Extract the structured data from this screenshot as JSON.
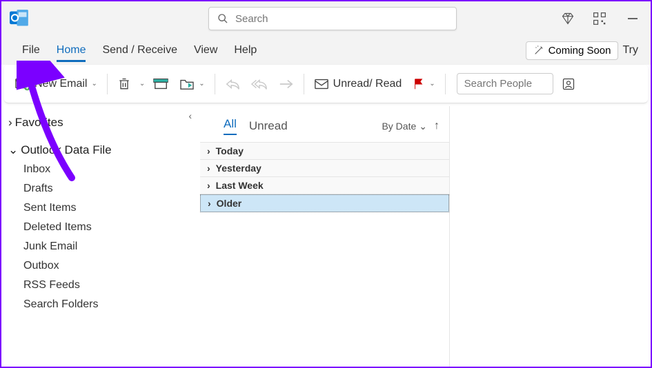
{
  "titlebar": {
    "search_placeholder": "Search"
  },
  "menubar": {
    "items": [
      "File",
      "Home",
      "Send / Receive",
      "View",
      "Help"
    ],
    "active_index": 1,
    "coming_soon": "Coming Soon",
    "try_label": "Try"
  },
  "ribbon": {
    "new_email": "New Email",
    "unread_read": "Unread/ Read",
    "search_people_placeholder": "Search People"
  },
  "sidebar": {
    "favorites_label": "Favorites",
    "datafile_label": "Outlook Data File",
    "folders": [
      "Inbox",
      "Drafts",
      "Sent Items",
      "Deleted Items",
      "Junk Email",
      "Outbox",
      "RSS Feeds",
      "Search Folders"
    ]
  },
  "listpane": {
    "tabs": [
      "All",
      "Unread"
    ],
    "active_tab": 0,
    "sort_label": "By Date",
    "groups": [
      "Today",
      "Yesterday",
      "Last Week",
      "Older"
    ],
    "selected_group": 3
  }
}
